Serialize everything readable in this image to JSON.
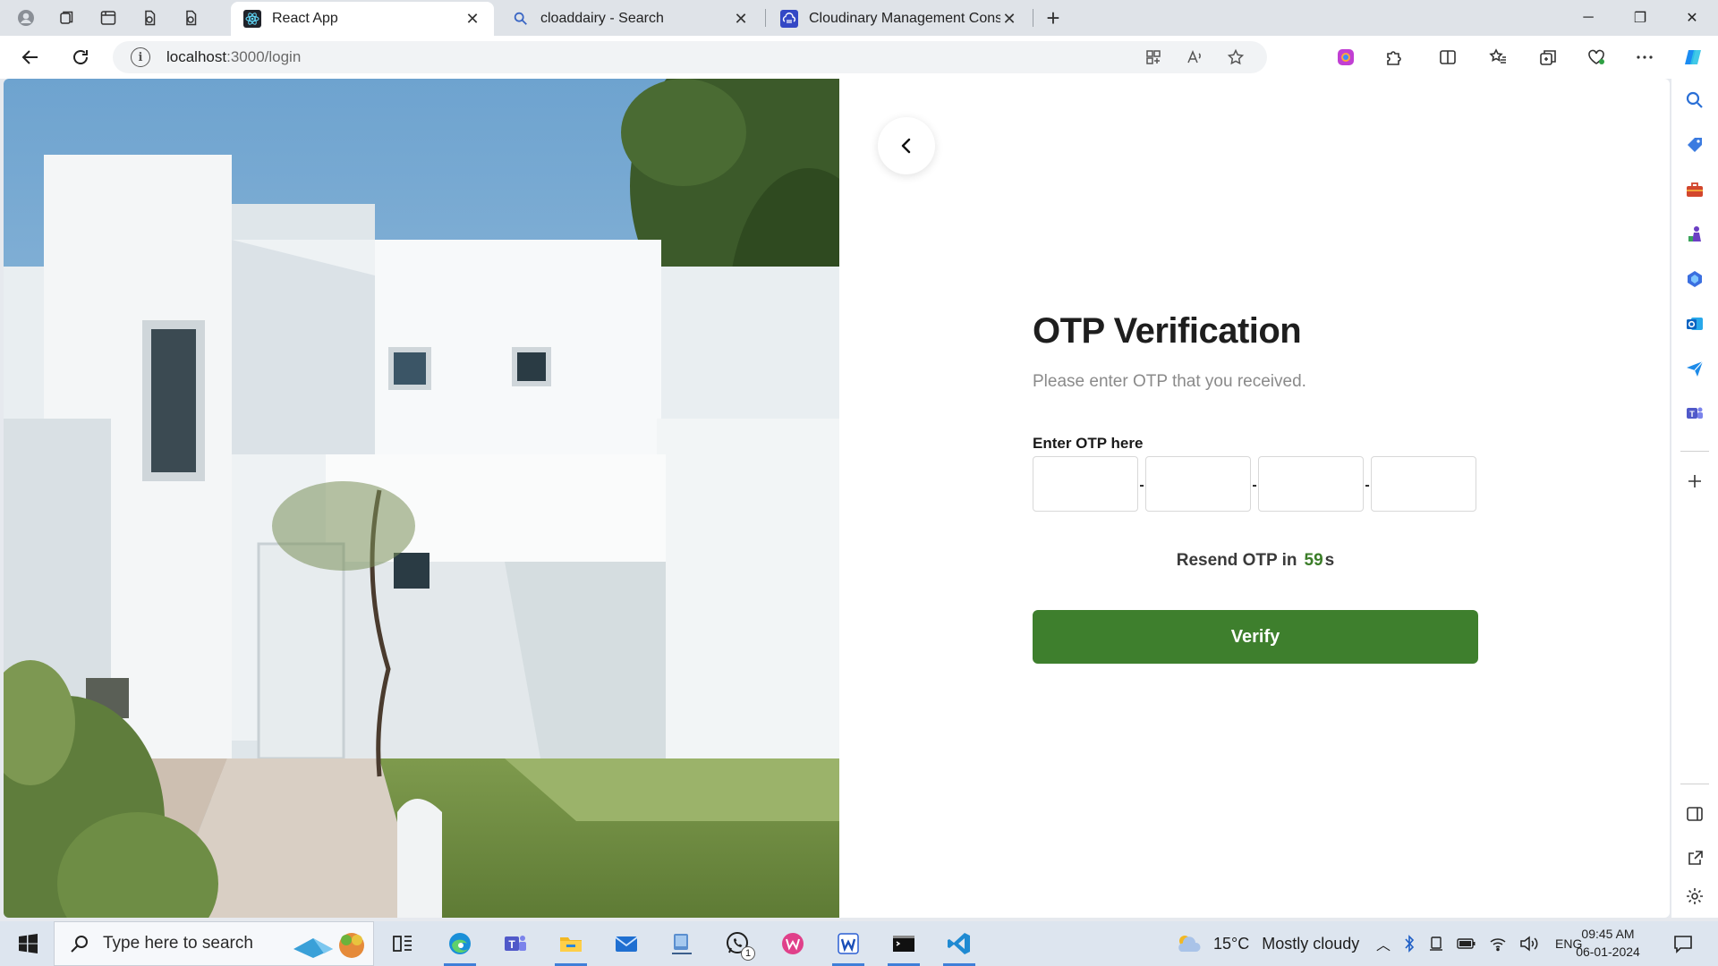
{
  "browser": {
    "tabs": [
      {
        "title": "React App",
        "icon": "react-icon",
        "active": true
      },
      {
        "title": "cloaddairy - Search",
        "icon": "search-icon",
        "active": false
      },
      {
        "title": "Cloudinary Management Console",
        "icon": "cloudinary-icon",
        "active": false
      }
    ],
    "url_host": "localhost",
    "url_path": ":3000/login"
  },
  "page": {
    "title": "OTP Verification",
    "subtitle": "Please enter OTP that you received.",
    "otp_label": "Enter OTP here",
    "otp_values": [
      "",
      "",
      "",
      ""
    ],
    "resend_prefix": "Resend OTP in",
    "resend_seconds": "59",
    "resend_unit": "s",
    "verify_label": "Verify",
    "accent_color": "#3e7f2d"
  },
  "taskbar": {
    "search_placeholder": "Type here to search",
    "weather_temp": "15°C",
    "weather_desc": "Mostly cloudy",
    "language": "ENG",
    "time": "09:45 AM",
    "date": "06-01-2024",
    "whatsapp_badge": "1"
  }
}
